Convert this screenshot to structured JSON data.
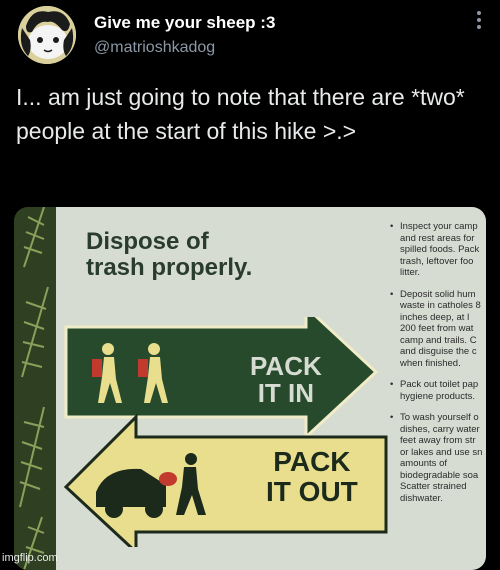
{
  "tweet": {
    "display_name": "Give me your sheep :3",
    "handle": "@matrioshkadog",
    "text": "I... am just going to note that there are *two* people at the start of this hike >.>",
    "more_icon": "more-vertical-icon"
  },
  "sign": {
    "title_line1": "Dispose of",
    "title_line2": "trash properly.",
    "pack_in_line1": "PACK",
    "pack_in_line2": "IT IN",
    "pack_out_line1": "PACK",
    "pack_out_line2": "IT OUT",
    "bullets": [
      "Inspect your camp and rest areas for spilled foods. Pack trash, leftover foo litter.",
      "Deposit solid hum waste in catholes 8 inches deep, at l 200 feet from wat camp and trails. C and disguise the c when finished.",
      "Pack out toilet pap hygiene products.",
      "To wash yourself o dishes, carry water feet away from str or lakes and use sn amounts of biodegradable soa Scatter strained dishwater."
    ]
  },
  "watermark": "imgflip.com",
  "colors": {
    "background": "#000000",
    "handle": "#8b98a5",
    "sign_green": "#274a2c",
    "sign_yellow": "#e8de8e",
    "sign_bg": "#d7dcd2"
  }
}
